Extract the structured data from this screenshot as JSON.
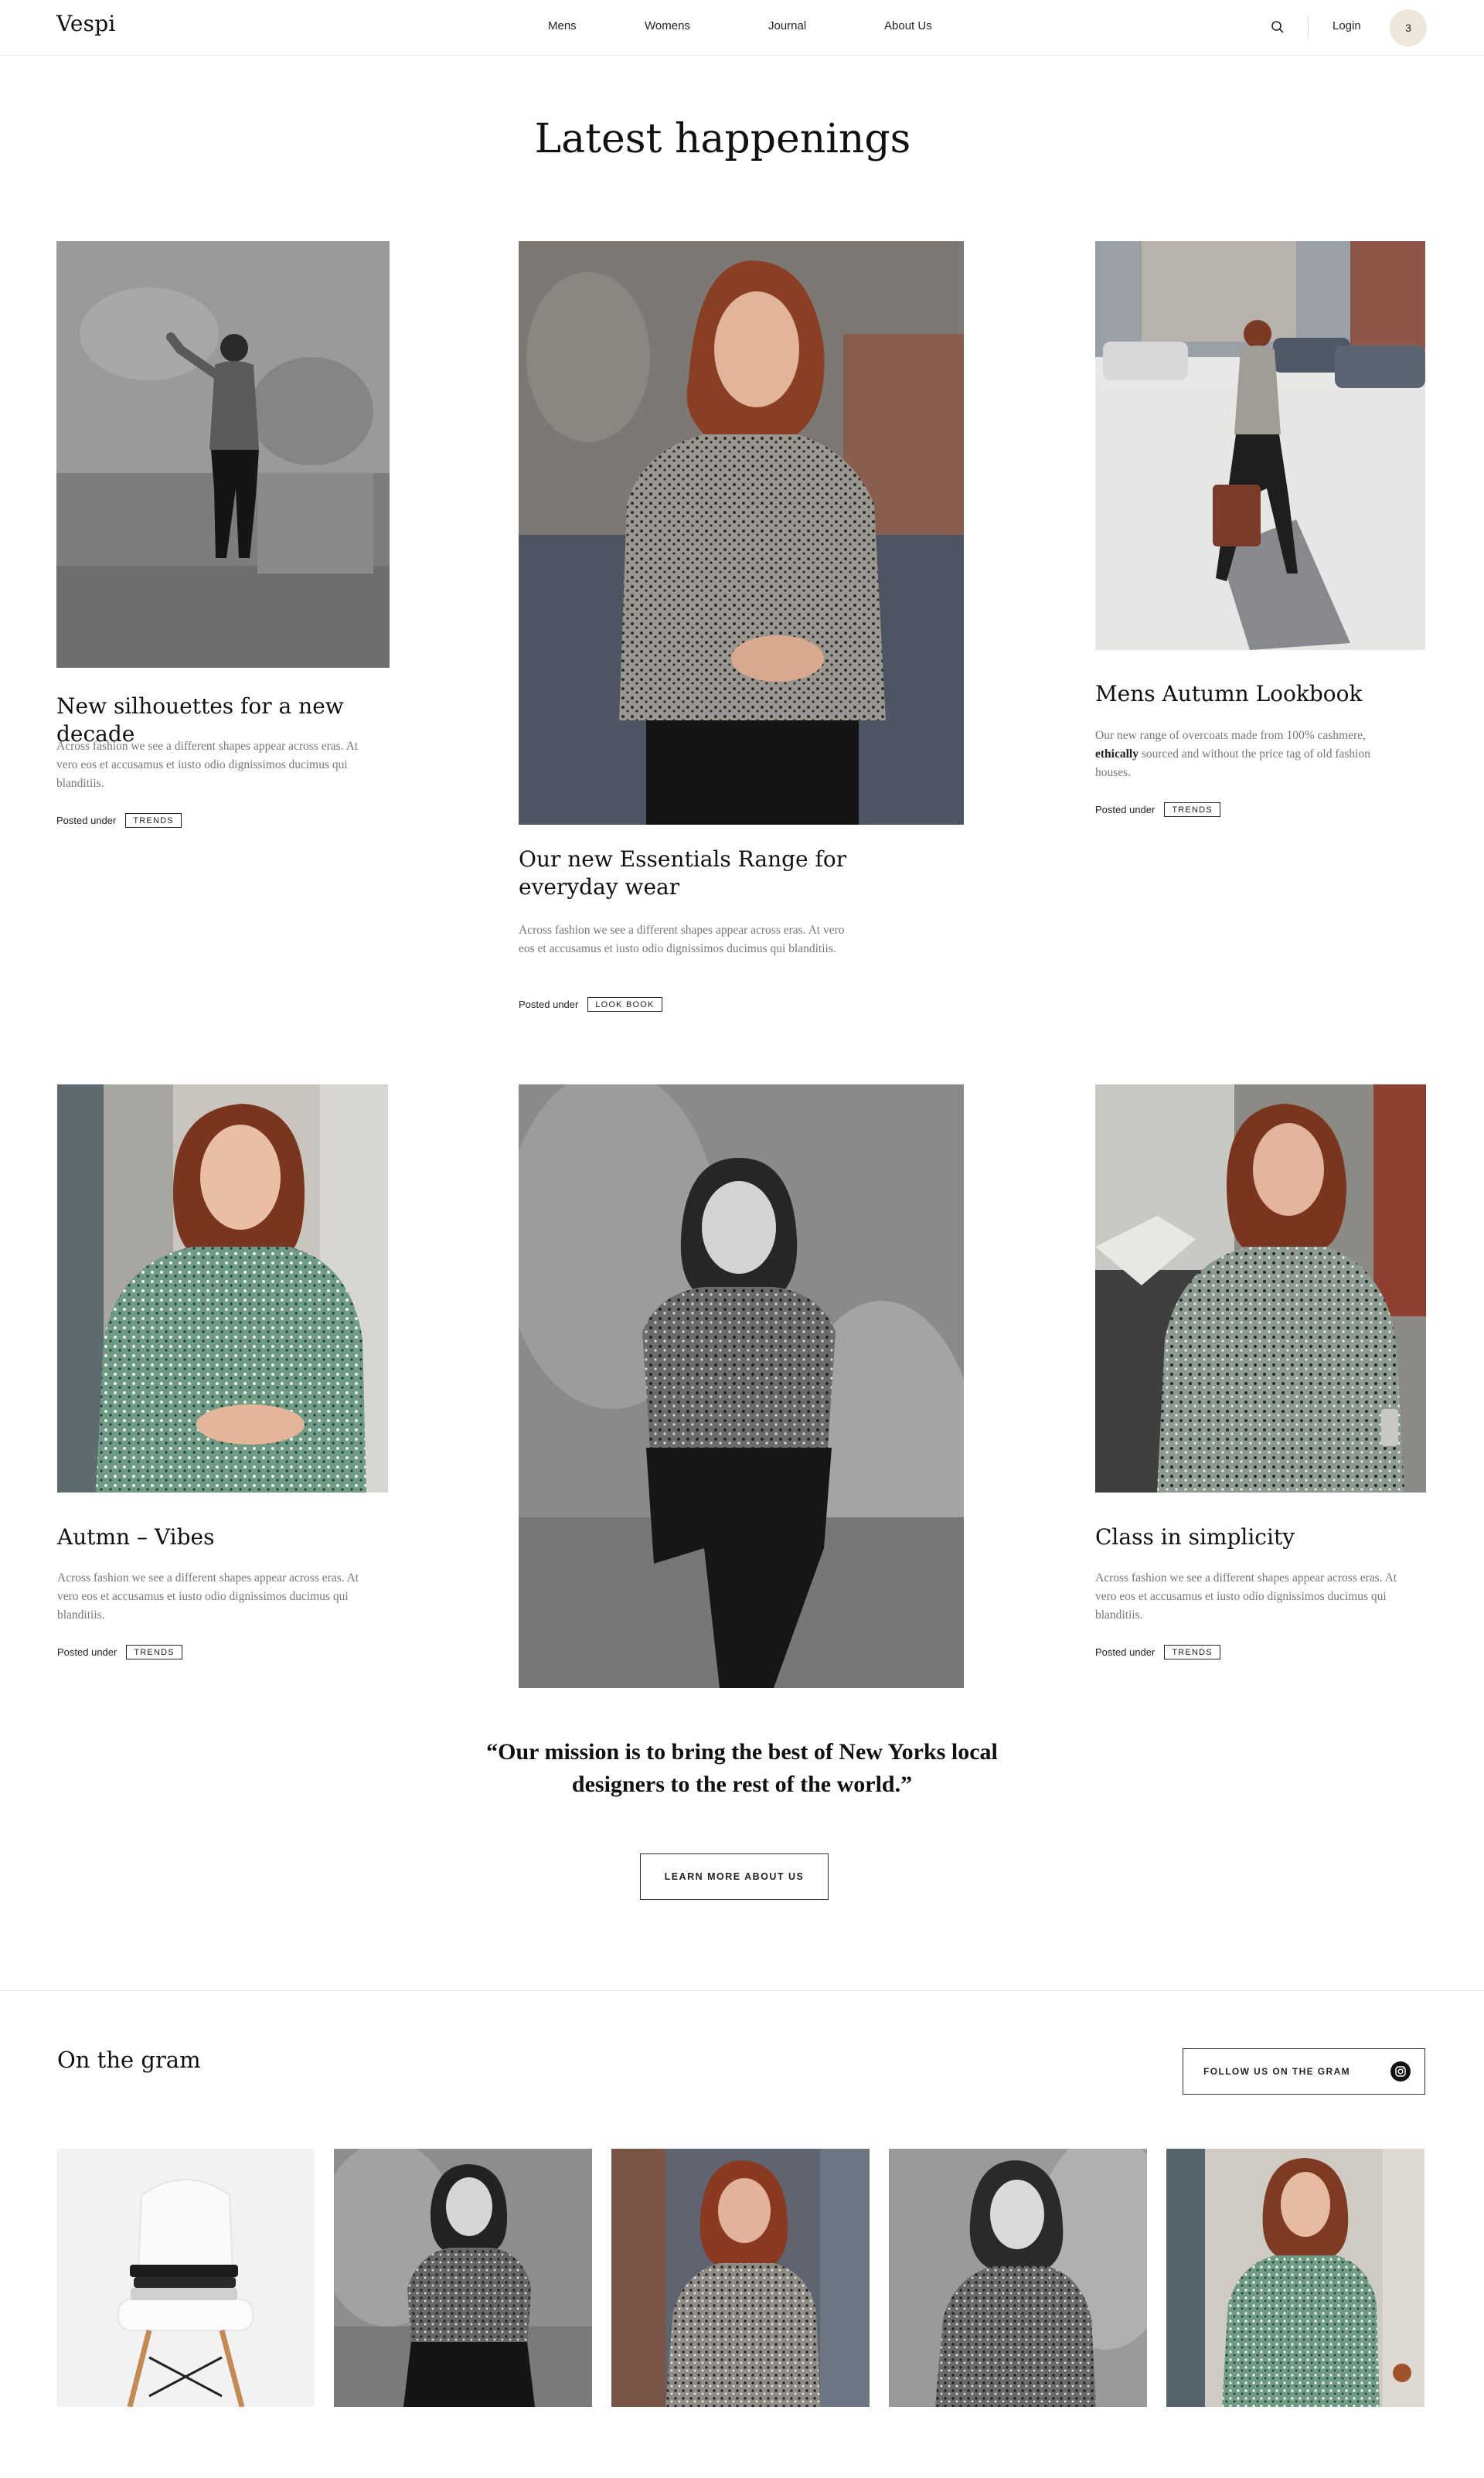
{
  "header": {
    "logo": "Vespi",
    "nav": [
      "Mens",
      "Womens",
      "Journal",
      "About Us"
    ],
    "login": "Login",
    "cart_count": "3"
  },
  "main": {
    "title": "Latest happenings",
    "posted_label": "Posted under",
    "cards": [
      {
        "title": "New silhouettes for a new decade",
        "text": "Across fashion we see a different shapes appear across eras. At vero eos et accusamus et iusto odio dignissimos ducimus qui blanditiis.",
        "tag": "TRENDS"
      },
      {
        "title": "Our new Essentials Range for everyday wear",
        "text": "Across fashion we see a different shapes appear across eras. At vero eos et accusamus et iusto odio dignissimos ducimus qui blanditiis.",
        "tag": "LOOK BOOK"
      },
      {
        "title": "Mens Autumn Lookbook",
        "text_before": "Our new range of overcoats made from 100% cashmere,",
        "text_bold": "ethically",
        "text_after": "sourced and without the price tag of old fashion houses.",
        "tag": "TRENDS"
      },
      {
        "title": "Autmn – Vibes",
        "text": "Across fashion we see a different shapes appear across eras. At vero eos et accusamus et iusto odio dignissimos ducimus qui blanditiis.",
        "tag": "TRENDS"
      },
      {
        "title": "Class in simplicity",
        "text": "Across fashion we see a different shapes appear across eras. At vero eos et accusamus et iusto odio dignissimos ducimus qui blanditiis.",
        "tag": "TRENDS"
      }
    ],
    "quote": "“Our mission is to bring the best of New Yorks local designers to the rest of the world.”",
    "cta": "LEARN MORE ABOUT US"
  },
  "gram": {
    "title": "On the gram",
    "follow": "FOLLOW US ON THE GRAM"
  },
  "icons": {
    "search": "search-icon",
    "instagram": "instagram-icon"
  },
  "colors": {
    "cart_badge": "#efe7dc",
    "text": "#1b1b1b",
    "muted_text": "#777777"
  }
}
